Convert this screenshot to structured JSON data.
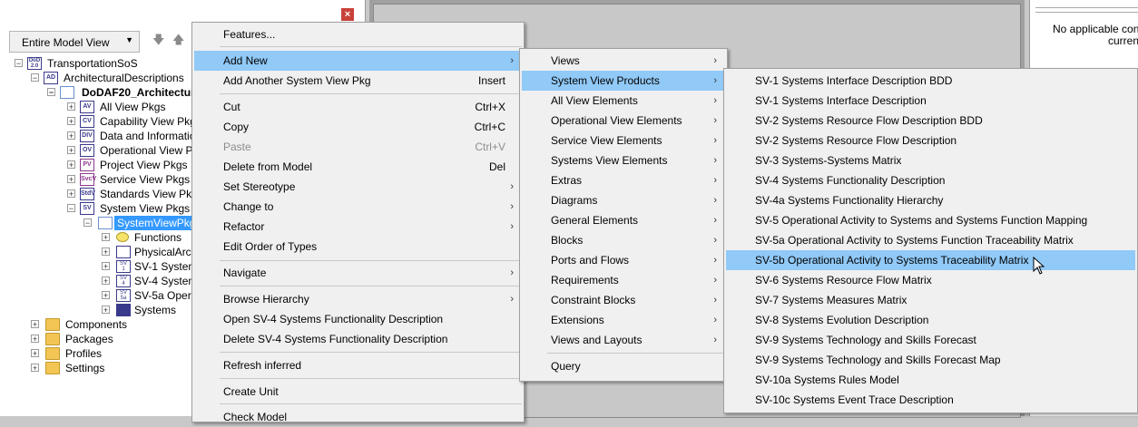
{
  "left_panel": {
    "view_select": "Entire Model View",
    "close_icon": "×",
    "tree": [
      {
        "label": "TransportationSoS",
        "icon": "DoD 2.0"
      },
      {
        "label": "ArchitecturalDescriptions",
        "icon": "AD"
      },
      {
        "label": "DoDAF20_Architectur",
        "icon": "folder-open"
      },
      {
        "label": "All View Pkgs",
        "icon": "AV"
      },
      {
        "label": "Capability View Pkg",
        "icon": "CV"
      },
      {
        "label": "Data and Informatio",
        "icon": "DIV"
      },
      {
        "label": "Operational View P",
        "icon": "OV"
      },
      {
        "label": "Project View Pkgs",
        "icon": "PV"
      },
      {
        "label": "Service View Pkgs",
        "icon": "SvcV"
      },
      {
        "label": "Standards View Pkg",
        "icon": "StdV"
      },
      {
        "label": "System View Pkgs",
        "icon": "SV"
      },
      {
        "label": "SystemViewPkg",
        "icon": "folder-open"
      },
      {
        "label": "Functions",
        "icon": "function"
      },
      {
        "label": "PhysicalArch",
        "icon": "grid"
      },
      {
        "label": "SV-1 System",
        "icon": "SV 1"
      },
      {
        "label": "SV-4 System",
        "icon": "SV 4"
      },
      {
        "label": "SV-5a Opera",
        "icon": "SV 5a"
      },
      {
        "label": "Systems",
        "icon": "grid"
      },
      {
        "label": "Components",
        "icon": "folder"
      },
      {
        "label": "Packages",
        "icon": "folder"
      },
      {
        "label": "Profiles",
        "icon": "folder"
      },
      {
        "label": "Settings",
        "icon": "folder"
      }
    ]
  },
  "right_panel": {
    "text_line1": "No applicable cont",
    "text_line2": "current"
  },
  "context_menu": [
    {
      "label": "Features...",
      "shortcut": ""
    },
    {
      "label": "Add New",
      "shortcut": "",
      "arrow": "›"
    },
    {
      "label": "Add Another System View Pkg",
      "shortcut": "Insert"
    },
    {
      "label": "Cut",
      "shortcut": "Ctrl+X"
    },
    {
      "label": "Copy",
      "shortcut": "Ctrl+C"
    },
    {
      "label": "Paste",
      "shortcut": "Ctrl+V"
    },
    {
      "label": "Delete from Model",
      "shortcut": "Del"
    },
    {
      "label": "Set Stereotype",
      "shortcut": "",
      "arrow": "›"
    },
    {
      "label": "Change to",
      "shortcut": "",
      "arrow": "›"
    },
    {
      "label": "Refactor",
      "shortcut": "",
      "arrow": "›"
    },
    {
      "label": "Edit Order of Types",
      "shortcut": ""
    },
    {
      "label": "Navigate",
      "shortcut": "",
      "arrow": "›"
    },
    {
      "label": "Browse Hierarchy",
      "shortcut": "",
      "arrow": "›"
    },
    {
      "label": "Open SV-4 Systems Functionality Description",
      "shortcut": ""
    },
    {
      "label": "Delete SV-4 Systems Functionality Description",
      "shortcut": ""
    },
    {
      "label": "Refresh inferred",
      "shortcut": ""
    },
    {
      "label": "Create Unit",
      "shortcut": ""
    },
    {
      "label": "Check Model",
      "shortcut": ""
    }
  ],
  "add_new_menu": [
    {
      "label": "Views",
      "arrow": "›"
    },
    {
      "label": "System View Products",
      "arrow": "›"
    },
    {
      "label": "All View Elements",
      "arrow": "›"
    },
    {
      "label": "Operational View Elements",
      "arrow": "›"
    },
    {
      "label": "Service View Elements",
      "arrow": "›"
    },
    {
      "label": "Systems View Elements",
      "arrow": "›"
    },
    {
      "label": "Extras",
      "arrow": "›"
    },
    {
      "label": "Diagrams",
      "arrow": "›"
    },
    {
      "label": "General Elements",
      "arrow": "›"
    },
    {
      "label": "Blocks",
      "arrow": "›"
    },
    {
      "label": "Ports and Flows",
      "arrow": "›"
    },
    {
      "label": "Requirements",
      "arrow": "›"
    },
    {
      "label": "Constraint Blocks",
      "arrow": "›"
    },
    {
      "label": "Extensions",
      "arrow": "›"
    },
    {
      "label": "Views and Layouts",
      "arrow": "›"
    },
    {
      "label": "Query"
    }
  ],
  "system_view_products_menu": [
    "SV-1 Systems Interface Description BDD",
    "SV-1 Systems Interface Description",
    "SV-2 Systems Resource Flow Description BDD",
    "SV-2 Systems Resource Flow Description",
    "SV-3 Systems-Systems Matrix",
    "SV-4 Systems Functionality Description",
    "SV-4a Systems Functionality Hierarchy",
    "SV-5 Operational Activity to Systems and Systems Function Mapping",
    "SV-5a Operational Activity to Systems Function Traceability Matrix",
    "SV-5b Operational Activity to Systems Traceability Matrix",
    "SV-6 Systems Resource Flow Matrix",
    "SV-7 Systems Measures Matrix",
    "SV-8 Systems Evolution Description",
    "SV-9 Systems Technology and Skills Forecast",
    "SV-9 Systems Technology and Skills Forecast Map",
    "SV-10a Systems Rules Model",
    "SV-10c Systems Event Trace Description"
  ],
  "colors": {
    "highlight": "#91c9f7",
    "selection": "#3399ff",
    "menu_bg": "#f0f0f0"
  }
}
